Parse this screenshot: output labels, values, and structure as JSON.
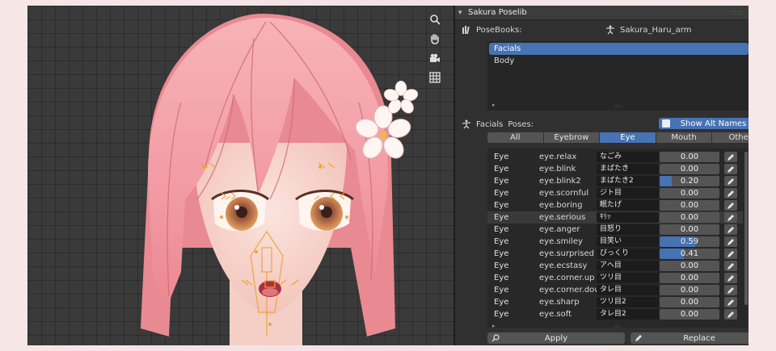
{
  "panel": {
    "title": "Sakura Poselib",
    "posebooks_label": "PoseBooks:",
    "armature": "Sakura_Haru_arm",
    "books": [
      "Facials",
      "Body"
    ],
    "active_book": "Facials",
    "book_name": "Facials",
    "poses_label": "Poses:",
    "show_alt_names": "Show Alt Names",
    "tabs": [
      "All",
      "Eyebrow",
      "Eye",
      "Mouth",
      "Other"
    ],
    "active_tab": "Eye",
    "apply": "Apply",
    "replace": "Replace"
  },
  "poses": [
    {
      "cat": "Eye",
      "name": "eye.relax",
      "alt": "なごみ",
      "value": "0.00",
      "v": 0.0
    },
    {
      "cat": "Eye",
      "name": "eye.blink",
      "alt": "まばたき",
      "value": "0.00",
      "v": 0.0
    },
    {
      "cat": "Eye",
      "name": "eye.blink2",
      "alt": "まばたき2",
      "value": "0.20",
      "v": 0.2
    },
    {
      "cat": "Eye",
      "name": "eye.scornful",
      "alt": "ジト目",
      "value": "0.00",
      "v": 0.0
    },
    {
      "cat": "Eye",
      "name": "eye.boring",
      "alt": "眠たげ",
      "value": "0.00",
      "v": 0.0
    },
    {
      "cat": "Eye",
      "name": "eye.serious",
      "alt": "ｷﾘｯ",
      "value": "0.00",
      "v": 0.0
    },
    {
      "cat": "Eye",
      "name": "eye.anger",
      "alt": "目怒り",
      "value": "0.00",
      "v": 0.0
    },
    {
      "cat": "Eye",
      "name": "eye.smiley",
      "alt": "目笑い",
      "value": "0.59",
      "v": 0.59
    },
    {
      "cat": "Eye",
      "name": "eye.surprised",
      "alt": "びっくり",
      "value": "0.41",
      "v": 0.41
    },
    {
      "cat": "Eye",
      "name": "eye.ecstasy",
      "alt": "アヘ目",
      "value": "0.00",
      "v": 0.0
    },
    {
      "cat": "Eye",
      "name": "eye.corner.up",
      "alt": "ツリ目",
      "value": "0.00",
      "v": 0.0
    },
    {
      "cat": "Eye",
      "name": "eye.corner.down",
      "alt": "タレ目",
      "value": "0.00",
      "v": 0.0
    },
    {
      "cat": "Eye",
      "name": "eye.sharp",
      "alt": "ツリ目2",
      "value": "0.00",
      "v": 0.0
    },
    {
      "cat": "Eye",
      "name": "eye.soft",
      "alt": "タレ目2",
      "value": "0.00",
      "v": 0.0
    }
  ],
  "colors": {
    "accent": "#4772b3",
    "panel_bg": "#303030",
    "viewport_bg": "#3a3a3a",
    "hair": "#f4a7ae"
  },
  "icons": {
    "nav": [
      "zoom-icon",
      "hand-icon",
      "camera-icon",
      "grid-icon"
    ]
  }
}
